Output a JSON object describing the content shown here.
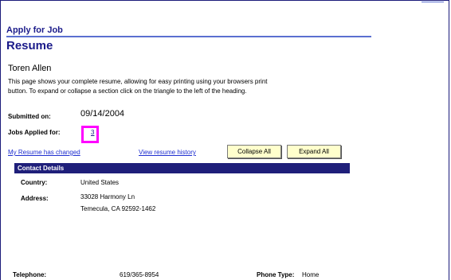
{
  "section": {
    "title": "Apply for Job"
  },
  "page": {
    "title": "Resume",
    "person_name": "Toren Allen",
    "intro_line1": "This page shows your complete resume, allowing for easy printing using your browsers print",
    "intro_line2": "button. To expand or collapse a section click on the triangle to the left of the heading."
  },
  "summary": {
    "submitted_label": "Submitted on:",
    "submitted_value": "09/14/2004",
    "jobs_label": "Jobs Applied for:",
    "jobs_value": "3"
  },
  "links": {
    "resume_changed": "My Resume has changed",
    "resume_history": "View resume history"
  },
  "buttons": {
    "collapse_all": "Collapse All",
    "expand_all": "Expand All"
  },
  "contact": {
    "header": "Contact Details",
    "country_label": "Country:",
    "country_value": "United States",
    "address_label": "Address:",
    "address_line1": "33028 Harmony Ln",
    "address_line2": "Temecula, CA 92592-1462",
    "telephone_label": "Telephone:",
    "telephone_value": "619/365-8954",
    "phone_type_label": "Phone Type:",
    "phone_type_value": "Home"
  },
  "colors": {
    "header_blue": "#1b1b8a",
    "bar_blue": "#1f1f7a",
    "highlight_magenta": "#ff00ff",
    "button_yellow": "#ffffcc"
  }
}
